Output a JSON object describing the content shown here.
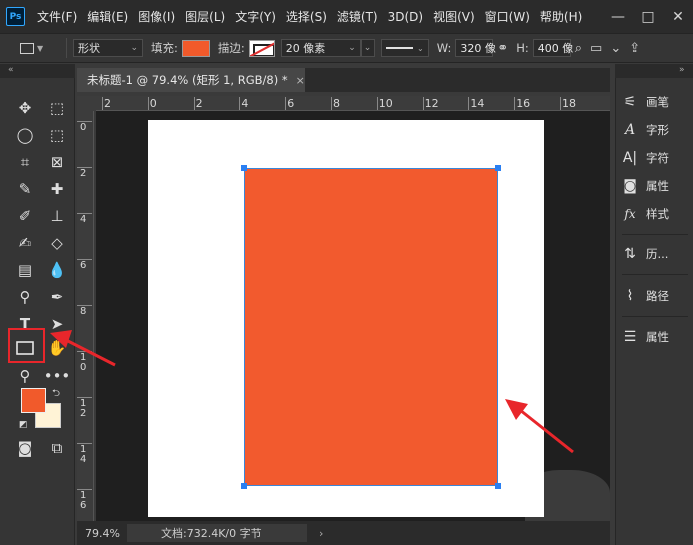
{
  "app": {
    "logo": "Ps"
  },
  "menu": [
    "文件(F)",
    "编辑(E)",
    "图像(I)",
    "图层(L)",
    "文字(Y)",
    "选择(S)",
    "滤镜(T)",
    "3D(D)",
    "视图(V)",
    "窗口(W)",
    "帮助(H)"
  ],
  "window_controls": {
    "minimize": "—",
    "maximize": "□",
    "close": "✕"
  },
  "options": {
    "mode_value": "形状",
    "fill_label": "填充:",
    "fill_color": "#f15a2b",
    "stroke_label": "描边:",
    "stroke_width": "20 像素",
    "width_label": "W:",
    "width_value": "320 像",
    "height_label": "H:",
    "height_value": "400 像"
  },
  "document": {
    "tab_title": "未标题-1 @ 79.4% (矩形 1, RGB/8) *",
    "tab_close": "×",
    "shape_color": "#f25a2e"
  },
  "ruler": {
    "h_labels": [
      "2",
      "0",
      "2",
      "4",
      "6",
      "8",
      "10",
      "12",
      "14",
      "16",
      "18"
    ],
    "v_labels": [
      "0",
      "2",
      "4",
      "6",
      "8",
      "10",
      "12",
      "14",
      "16"
    ]
  },
  "toolbar": {
    "foreground_color": "#f15a2b",
    "background_color": "#fff3d6"
  },
  "status": {
    "zoom": "79.4%",
    "doc_info": "文档:732.4K/0 字节",
    "arrow": "›"
  },
  "panels": [
    {
      "icon": "brush-settings-icon",
      "label": "画笔"
    },
    {
      "icon": "character-icon",
      "label": "字形"
    },
    {
      "icon": "paragraph-icon",
      "label": "字符"
    },
    {
      "icon": "properties-icon",
      "label": "属性"
    },
    {
      "icon": "styles-icon",
      "label": "样式"
    },
    {
      "icon": "history-icon",
      "label": "历..."
    },
    {
      "icon": "paths-icon",
      "label": "路径"
    },
    {
      "icon": "adjustments-icon",
      "label": "属性"
    }
  ]
}
